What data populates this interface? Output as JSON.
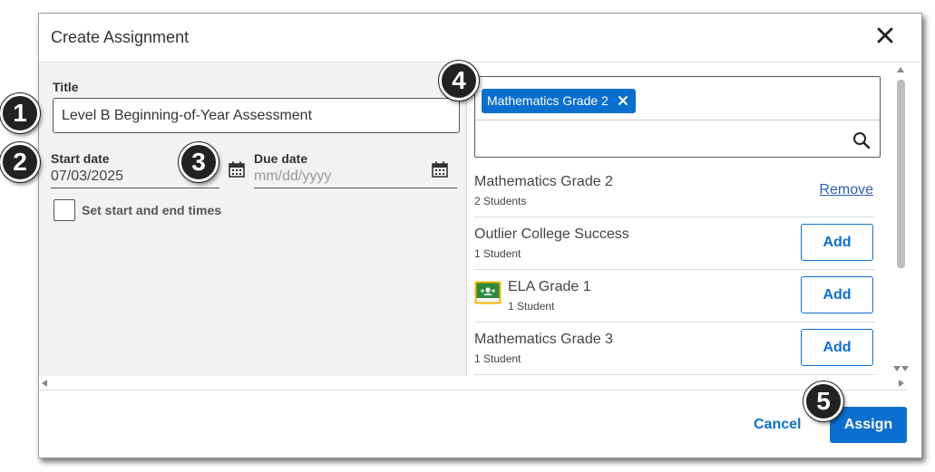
{
  "dialog": {
    "title": "Create Assignment"
  },
  "form": {
    "title_label": "Title",
    "title_value": "Level B Beginning-of-Year Assessment",
    "start_date_label": "Start date",
    "start_date_value": "07/03/2025",
    "due_date_label": "Due date",
    "due_date_placeholder": "mm/dd/yyyy",
    "times_checkbox_label": "Set start and end times",
    "times_checkbox_checked": false
  },
  "class_picker": {
    "selected_chip": "Mathematics Grade 2",
    "search_placeholder": "",
    "remove_label": "Remove",
    "add_label": "Add",
    "classes": [
      {
        "name": "Mathematics Grade 2",
        "count": "2 Students",
        "selected": true,
        "icon": ""
      },
      {
        "name": "Outlier College Success",
        "count": "1 Student",
        "selected": false,
        "icon": ""
      },
      {
        "name": "ELA Grade 1",
        "count": "1 Student",
        "selected": false,
        "icon": "google-classroom-icon"
      },
      {
        "name": "Mathematics Grade 3",
        "count": "1 Student",
        "selected": false,
        "icon": ""
      }
    ]
  },
  "footer": {
    "cancel_label": "Cancel",
    "assign_label": "Assign"
  },
  "callouts": [
    "1",
    "2",
    "3",
    "4",
    "5"
  ],
  "colors": {
    "accent": "#0b6fcf",
    "link": "#2b5fb0",
    "left_pane_bg": "#f2f2f2",
    "classroom_green": "#2e8b3e",
    "classroom_yellow": "#f4b400"
  }
}
